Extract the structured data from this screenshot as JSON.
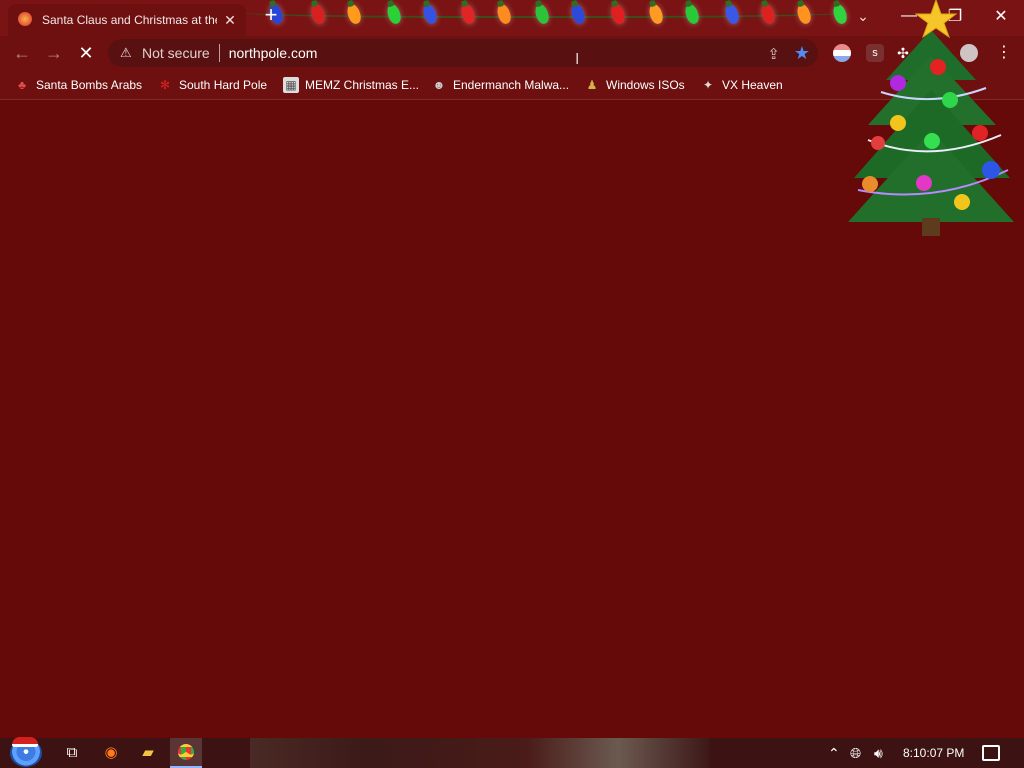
{
  "browser": {
    "tab_title": "Santa Claus and Christmas at the",
    "new_tab": "+",
    "security_label": "Not secure",
    "url": "northpole.com",
    "extension_s": "s"
  },
  "bookmarks": [
    {
      "label": "Santa Bombs Arabs"
    },
    {
      "label": "South Hard Pole"
    },
    {
      "label": "MEMZ Christmas E..."
    },
    {
      "label": "Endermanch Malwa..."
    },
    {
      "label": "Windows ISOs"
    },
    {
      "label": "VX Heaven"
    }
  ],
  "taskbar": {
    "clock": "8:10:07 PM"
  },
  "colors": {
    "page_bg": "#650909",
    "chrome_bg": "#6e1010",
    "star_accent": "#4f8cf6"
  },
  "icons": {
    "tab_favicon": "christmas-lights-icon",
    "reload": "stop-icon",
    "page_decoration": "christmas-tree-icon"
  }
}
